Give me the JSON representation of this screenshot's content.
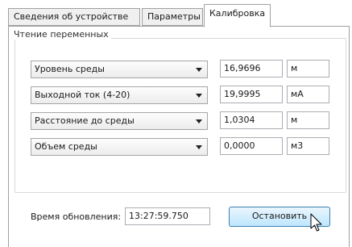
{
  "tabs": [
    {
      "label": "Сведения об устройстве"
    },
    {
      "label": "Параметры"
    },
    {
      "label": "Калибровка"
    }
  ],
  "group": {
    "title": "Чтение переменных"
  },
  "rows": [
    {
      "variable": "Уровень среды",
      "value": "16,9696",
      "unit": "м"
    },
    {
      "variable": "Выходной ток (4-20)",
      "value": "19,9995",
      "unit": "мА"
    },
    {
      "variable": "Расстояние до среды",
      "value": "1,0304",
      "unit": "м"
    },
    {
      "variable": "Объем среды",
      "value": "0,0000",
      "unit": "м3"
    }
  ],
  "update": {
    "label": "Время обновления:",
    "value": "13:27:59.750"
  },
  "stop_button": {
    "label": "Остановить"
  },
  "icons": {
    "dropdown": "chevron-down-icon",
    "cursor": "mouse-pointer-icon"
  }
}
